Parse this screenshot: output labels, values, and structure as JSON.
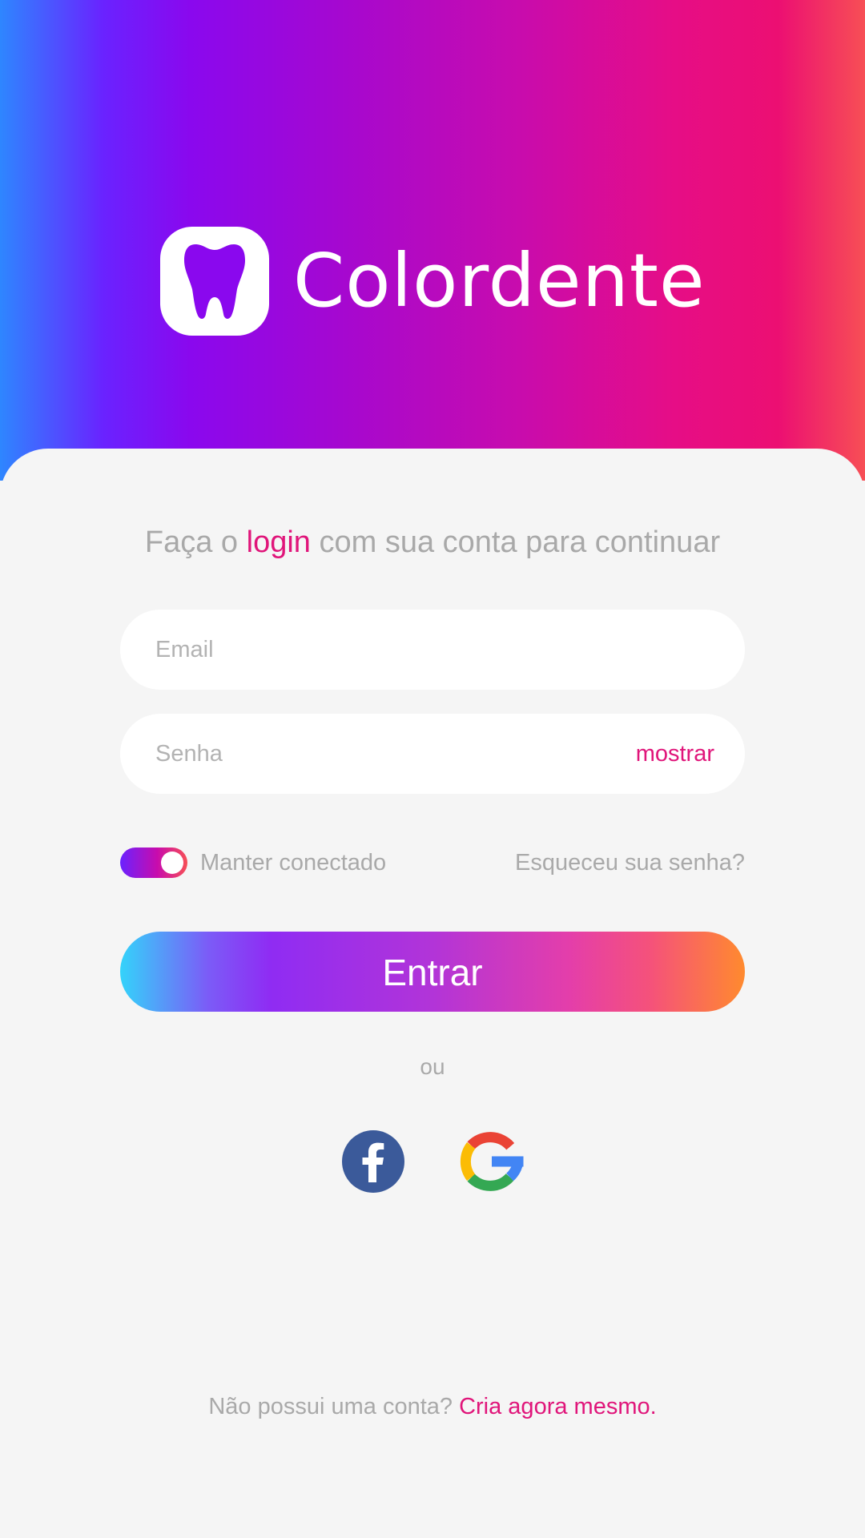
{
  "app": {
    "name": "Colordente",
    "logo_icon": "tooth-icon"
  },
  "login": {
    "headline_pre": "Faça o ",
    "headline_highlight": "login",
    "headline_post": " com sua conta para continuar",
    "email_placeholder": "Email",
    "password_placeholder": "Senha",
    "show_password_label": "mostrar",
    "keep_connected_label": "Manter conectado",
    "keep_connected_on": true,
    "forgot_password_label": "Esqueceu sua senha?",
    "submit_label": "Entrar",
    "or_label": "ou"
  },
  "social": [
    {
      "name": "facebook",
      "icon": "facebook-icon",
      "color": "#3b5a9a"
    },
    {
      "name": "google",
      "icon": "google-icon"
    }
  ],
  "signup": {
    "prompt": "Não possui uma conta? ",
    "link_label": "Cria agora mesmo."
  },
  "colors": {
    "accent": "#e0157a",
    "muted_text": "#a9a9a9",
    "background": "#f5f5f5"
  }
}
